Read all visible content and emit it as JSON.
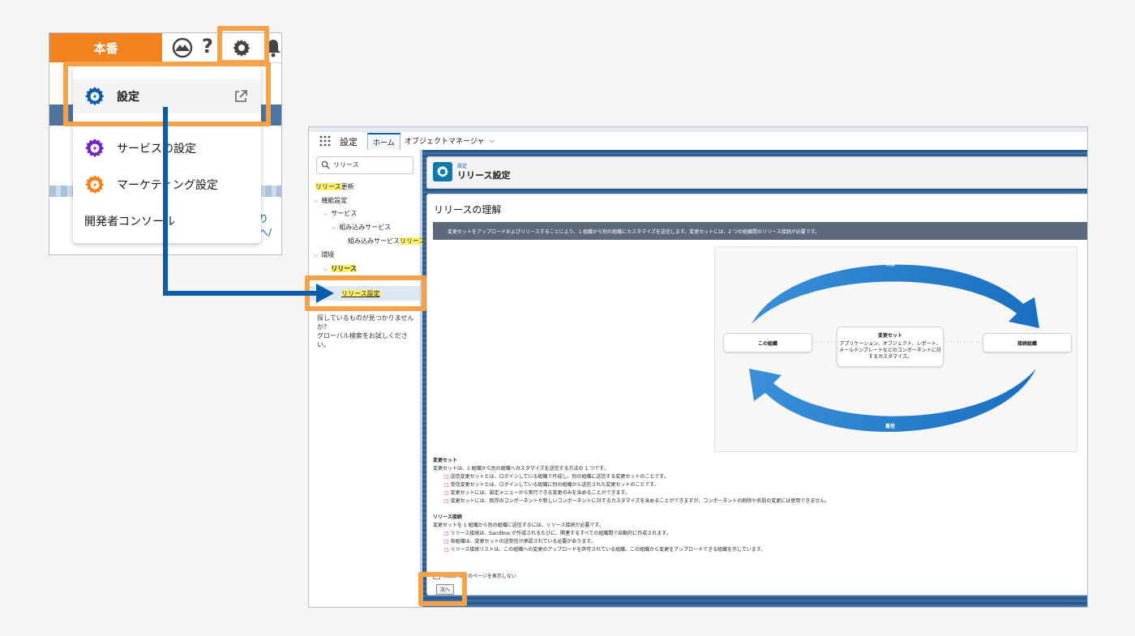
{
  "header": {
    "env_label": "本番",
    "help_glyph": "?",
    "icons": [
      "trailhead-icon",
      "help-icon",
      "gear-icon",
      "bell-icon"
    ]
  },
  "setup_menu": {
    "items": [
      {
        "label": "設定",
        "icon": "gear-icon",
        "color": "#0b5cab",
        "external": true
      },
      {
        "label": "サービスの設定",
        "icon": "gear-icon",
        "color": "#7526c2"
      },
      {
        "label": "マーケティング設定",
        "icon": "gear-icon",
        "color": "#f4821f"
      },
      {
        "label": "開発者コンソール"
      }
    ]
  },
  "background_link": "りへ/",
  "nav": {
    "app_name": "設定",
    "tabs": [
      {
        "label": "ホーム",
        "active": true
      },
      {
        "label": "オブジェクトマネージャ",
        "has_dropdown": true
      }
    ]
  },
  "sidebar": {
    "quick_find": "リリース",
    "tree": [
      {
        "text_plain": "",
        "text_mark": "リリース",
        "text_after": "更新"
      },
      {
        "label": "機能設定"
      },
      {
        "label": "サービス"
      },
      {
        "label": "組み込みサービス"
      },
      {
        "text_plain": "組み込みサービス",
        "text_mark": "リリース"
      },
      {
        "label": "環境"
      },
      {
        "label": "リリース"
      },
      {
        "label": "リリース設定",
        "selected": true
      }
    ],
    "help_line1": "探しているものが見つかりませんか?",
    "help_line2": "グローバル検索をお試しください。"
  },
  "page": {
    "breadcrumb": "設定",
    "title": "リリース設定",
    "card_title": "リリースの理解",
    "banner": "変更セットをアップロードおよびリリースすることにより、1 組織から別の組織にカスタマイズを送信します。変更セットには、2 つの組織間のリリース接続が必要です。"
  },
  "diagram": {
    "send_label": "発信",
    "receive_label": "着信",
    "this_org": "この組織",
    "connected_org": "接続組織",
    "center_title": "変更セット",
    "center_text": "アプリケーション、オブジェクト、レポート、メールテンプレートなどのコンポーネントに対するカスタマイズ。",
    "arrow_color": "#1e7fd0"
  },
  "text_block": {
    "changeset_heading": "変更セット",
    "changeset_intro": "変更セットは、1 組織から別の組織へカスタマイズを送信する方法の 1 つです。",
    "changeset_items": [
      "送信変更セットとは、ログインしている組織で作成し、別の組織に送信する変更セットのことです。",
      "受信変更セットとは、ログインしている組織に別の組織から送信された変更セットのことです。",
      "変更セットには、設定メニューから実行できる変更のみを含めることができます。",
      "変更セットには、既存のコンポーネントや新しいコンポーネントに対するカスタマイズを含めることができますが、コンポーネントの削除や名前の変更には使用できません。"
    ],
    "connection_heading": "リリース接続",
    "connection_intro": "変更セットを 1 組織から別の組織に送信するには、リリース接続が必要です。",
    "connection_items": [
      "リリース接続は、Sandbox が作成されるたびに、関連するすべての組織間で自動的に作成されます。",
      "各組織は、変更セットの送受信が承認されている必要があります。",
      "リリース接続リストは、この組織への変更のアップロードを許可されている組織、この組織から変更をアップロードできる組織を示しています。"
    ]
  },
  "dont_show": "次回からこのページを表示しない",
  "next_button": "次へ",
  "colors": {
    "env_orange": "#f4821f",
    "highlight": "#f6a24a",
    "guide_arrow": "#0b5cab"
  }
}
